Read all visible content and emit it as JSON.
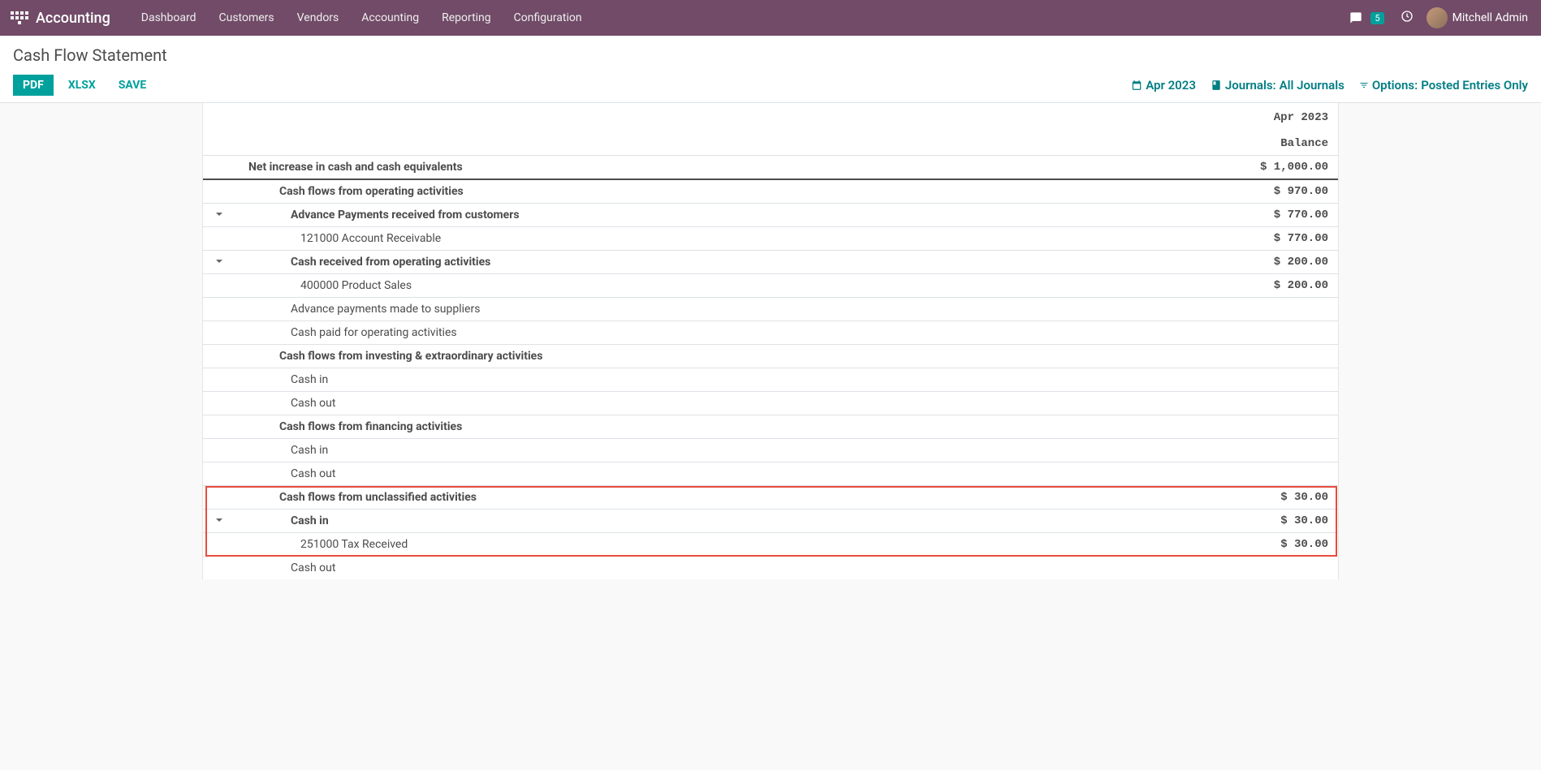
{
  "nav": {
    "brand": "Accounting",
    "items": [
      "Dashboard",
      "Customers",
      "Vendors",
      "Accounting",
      "Reporting",
      "Configuration"
    ],
    "messages_count": "5",
    "username": "Mitchell Admin"
  },
  "page": {
    "title": "Cash Flow Statement",
    "btn_pdf": "PDF",
    "btn_xlsx": "XLSX",
    "btn_save": "SAVE",
    "filter_date": "Apr 2023",
    "filter_journals_label": "Journals: ",
    "filter_journals_value": "All Journals",
    "filter_options_label": "Options:",
    "filter_options_value": "Posted Entries Only"
  },
  "report": {
    "col_period": "Apr 2023",
    "col_balance": "Balance",
    "rows": [
      {
        "label": "Net increase in cash and cash equivalents",
        "value": "$ 1,000.00",
        "bold": true,
        "indent": 0,
        "caret": false,
        "total": true
      },
      {
        "label": "Cash flows from operating activities",
        "value": "$ 970.00",
        "bold": true,
        "indent": 1,
        "caret": false
      },
      {
        "label": "Advance Payments received from customers",
        "value": "$ 770.00",
        "bold": true,
        "indent": 2,
        "caret": true
      },
      {
        "label": "121000 Account Receivable",
        "value": "$ 770.00",
        "bold": false,
        "indent": 3,
        "caret": false
      },
      {
        "label": "Cash received from operating activities",
        "value": "$ 200.00",
        "bold": true,
        "indent": 2,
        "caret": true
      },
      {
        "label": "400000 Product Sales",
        "value": "$ 200.00",
        "bold": false,
        "indent": 3,
        "caret": false
      },
      {
        "label": "Advance payments made to suppliers",
        "value": "",
        "bold": false,
        "indent": 2,
        "caret": false
      },
      {
        "label": "Cash paid for operating activities",
        "value": "",
        "bold": false,
        "indent": 2,
        "caret": false
      },
      {
        "label": "Cash flows from investing & extraordinary activities",
        "value": "",
        "bold": true,
        "indent": 1,
        "caret": false
      },
      {
        "label": "Cash in",
        "value": "",
        "bold": false,
        "indent": 2,
        "caret": false
      },
      {
        "label": "Cash out",
        "value": "",
        "bold": false,
        "indent": 2,
        "caret": false
      },
      {
        "label": "Cash flows from financing activities",
        "value": "",
        "bold": true,
        "indent": 1,
        "caret": false
      },
      {
        "label": "Cash in",
        "value": "",
        "bold": false,
        "indent": 2,
        "caret": false
      },
      {
        "label": "Cash out",
        "value": "",
        "bold": false,
        "indent": 2,
        "caret": false
      },
      {
        "label": "Cash flows from unclassified activities",
        "value": "$ 30.00",
        "bold": true,
        "indent": 1,
        "caret": false,
        "hl": true
      },
      {
        "label": "Cash in",
        "value": "$ 30.00",
        "bold": true,
        "indent": 2,
        "caret": true,
        "hl": true
      },
      {
        "label": "251000 Tax Received",
        "value": "$ 30.00",
        "bold": false,
        "indent": 3,
        "caret": false,
        "hl": true
      },
      {
        "label": "Cash out",
        "value": "",
        "bold": false,
        "indent": 2,
        "caret": false
      }
    ]
  }
}
